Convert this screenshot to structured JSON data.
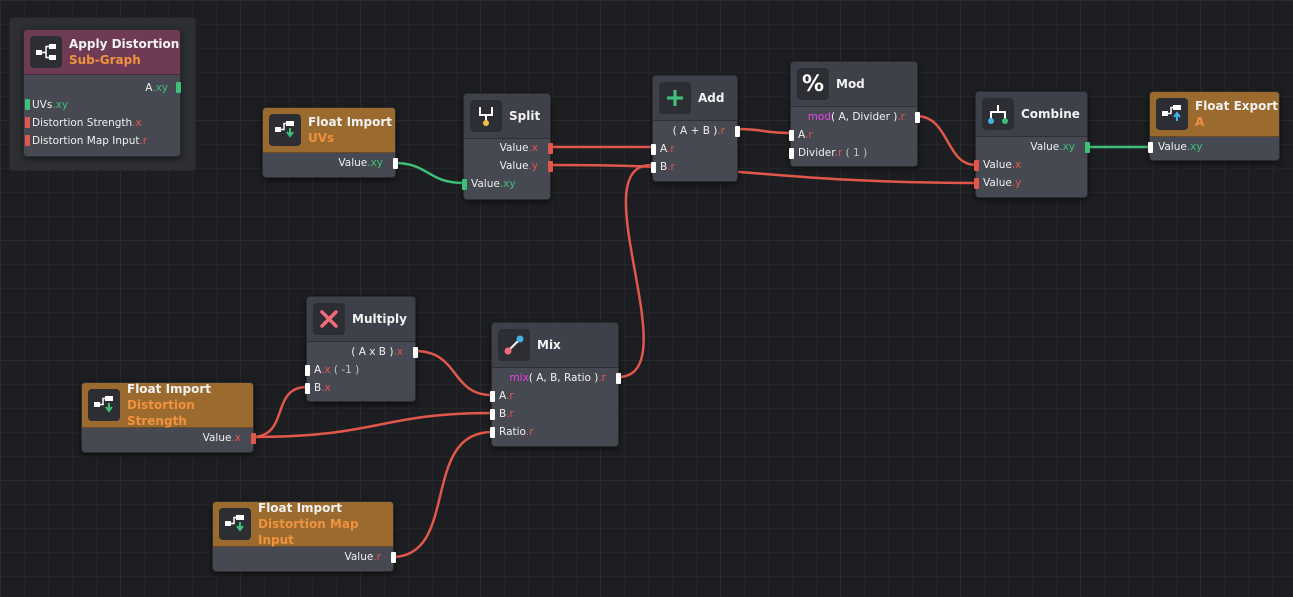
{
  "colors": {
    "background": "#1d1e21",
    "node": "#464951",
    "import_header": "#9a6a2f",
    "subgraph_header": "#6f3a53",
    "wire_red": "#e2574c",
    "wire_green": "#3fbf77",
    "function_magenta": "#e642e6",
    "subtitle_orange": "#f0923e"
  },
  "subgraph": {
    "title": "Apply Distortion",
    "subtitle": "Sub-Graph",
    "icon": "graph-icon",
    "output": {
      "name": "A",
      "channel": ".xy"
    },
    "inputs": [
      {
        "name": "UVs",
        "channel": ".xy"
      },
      {
        "name": "Distortion Strength",
        "channel": ".x"
      },
      {
        "name": "Distortion Map Input",
        "channel": ".r"
      }
    ]
  },
  "float_import_uvs": {
    "title": "Float Import",
    "subtitle": "UVs",
    "output": {
      "name": "Value",
      "channel": ".xy"
    },
    "icon": "import-icon"
  },
  "float_import_strength": {
    "title": "Float Import",
    "subtitle": "Distortion Strength",
    "output": {
      "name": "Value",
      "channel": ".x"
    },
    "icon": "import-icon"
  },
  "float_import_map": {
    "title": "Float Import",
    "subtitle": "Distortion Map Input",
    "output": {
      "name": "Value",
      "channel": ".r"
    },
    "icon": "import-icon"
  },
  "split": {
    "title": "Split",
    "icon": "split-icon",
    "outputs": [
      {
        "name": "Value",
        "channel": ".x"
      },
      {
        "name": "Value",
        "channel": ".y"
      }
    ],
    "input": {
      "name": "Value",
      "channel": ".xy"
    }
  },
  "add": {
    "title": "Add",
    "icon": "plus-icon",
    "output": {
      "expr": "( A + B )",
      "channel": ".r"
    },
    "inputs": [
      {
        "name": "A",
        "channel": ".r"
      },
      {
        "name": "B",
        "channel": ".r"
      }
    ]
  },
  "mod": {
    "title": "Mod",
    "icon": "percent-icon",
    "glyph": "%",
    "output": {
      "fn": "mod",
      "args": "( A, Divider )",
      "channel": ".r"
    },
    "inputs": [
      {
        "name": "A",
        "channel": ".r"
      },
      {
        "name": "Divider",
        "channel": ".r",
        "default": "( 1 )"
      }
    ]
  },
  "combine": {
    "title": "Combine",
    "icon": "combine-icon",
    "output": {
      "name": "Value",
      "channel": ".xy"
    },
    "inputs": [
      {
        "name": "Value",
        "channel": ".x"
      },
      {
        "name": "Value",
        "channel": ".y"
      }
    ]
  },
  "float_export": {
    "title": "Float Export",
    "subtitle": "A",
    "icon": "export-icon",
    "input": {
      "name": "Value",
      "channel": ".xy"
    }
  },
  "multiply": {
    "title": "Multiply",
    "icon": "multiply-icon",
    "output": {
      "expr": "( A x B )",
      "channel": ".x"
    },
    "inputs": [
      {
        "name": "A",
        "channel": ".x",
        "default": "( -1 )"
      },
      {
        "name": "B",
        "channel": ".x"
      }
    ]
  },
  "mix": {
    "title": "Mix",
    "icon": "mix-icon",
    "output": {
      "fn": "mix",
      "args": "( A, B, Ratio )",
      "channel": ".r"
    },
    "inputs": [
      {
        "name": "A",
        "channel": ".r"
      },
      {
        "name": "B",
        "channel": ".r"
      },
      {
        "name": "Ratio",
        "channel": ".r"
      }
    ]
  }
}
